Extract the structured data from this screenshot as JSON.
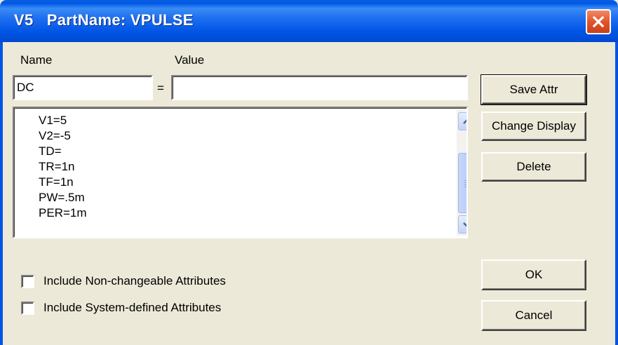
{
  "window": {
    "title": "V5   PartName: VPULSE",
    "close_icon": "close-icon"
  },
  "form": {
    "name_label": "Name",
    "value_label": "Value",
    "name_value": "DC",
    "equals": "=",
    "value_value": ""
  },
  "attributes": {
    "items": [
      "V1=5",
      "V2=-5",
      "TD=",
      "TR=1n",
      "TF=1n",
      "PW=.5m",
      "PER=1m"
    ]
  },
  "buttons": {
    "save_attr": "Save Attr",
    "change_display": "Change Display",
    "delete": "Delete",
    "ok": "OK",
    "cancel": "Cancel"
  },
  "options": {
    "non_changeable": "Include Non-changeable Attributes",
    "system_defined": "Include System-defined Attributes"
  },
  "colors": {
    "titlebar": "#0055e5",
    "dialog_bg": "#ece9d8",
    "close": "#e2542c"
  }
}
